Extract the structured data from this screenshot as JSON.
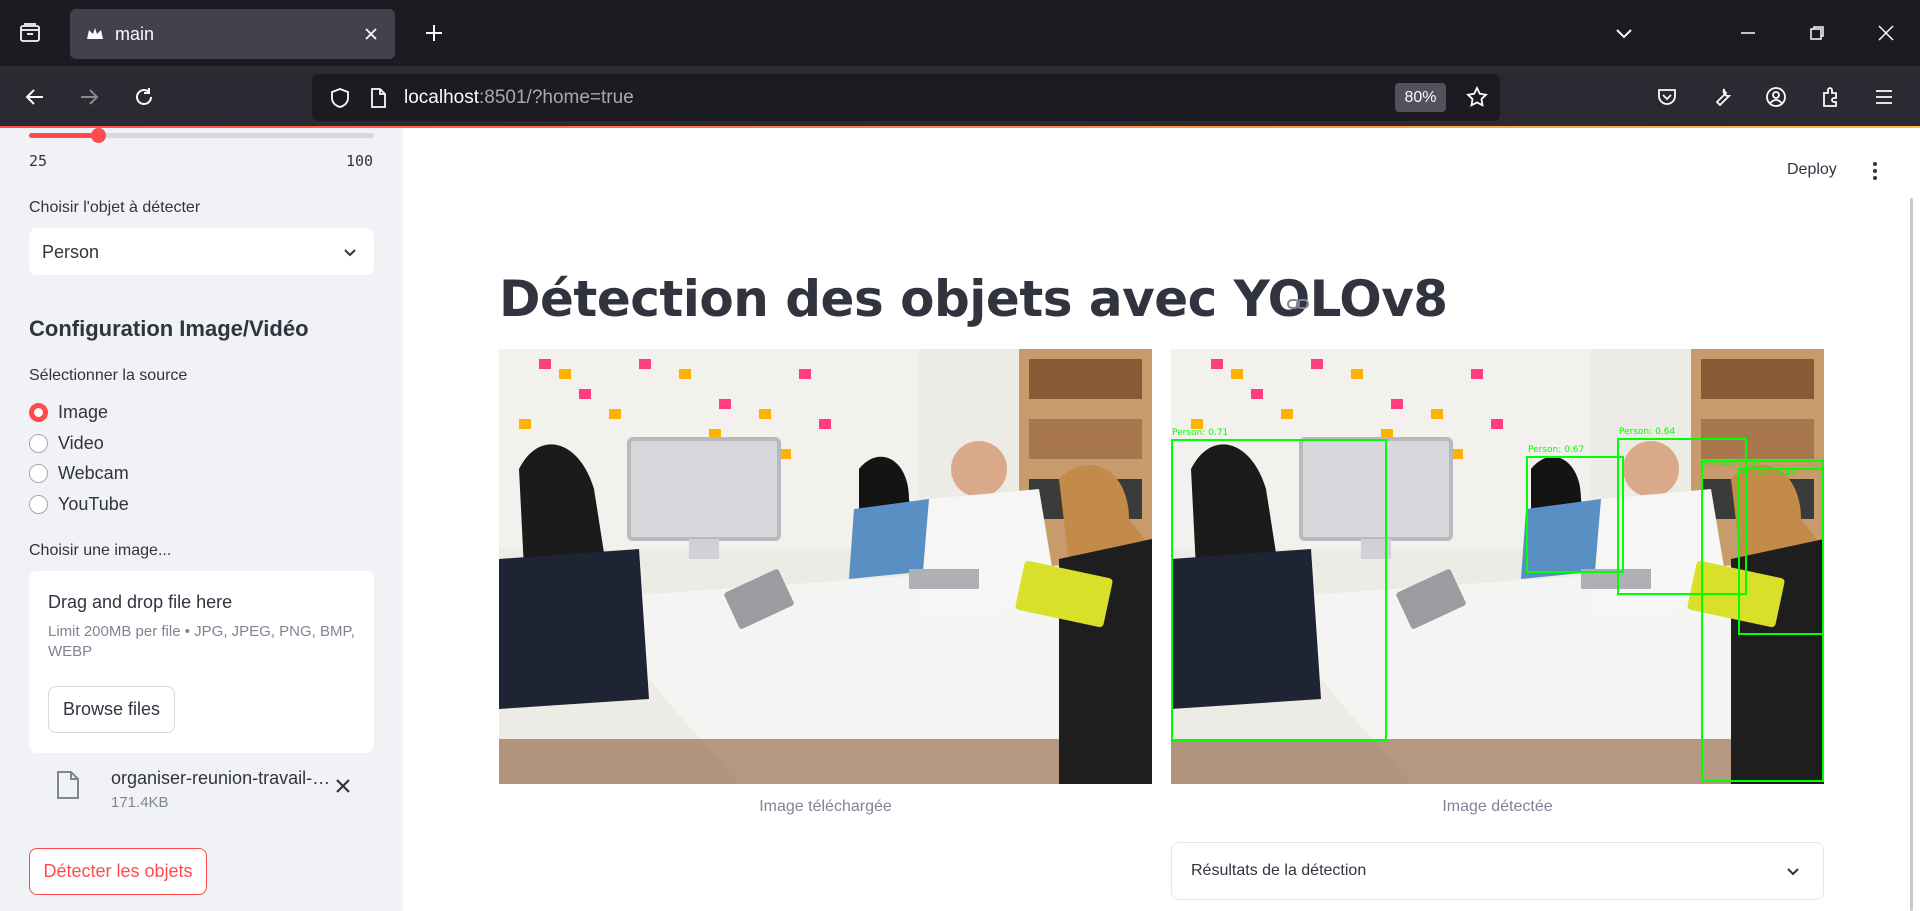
{
  "browser": {
    "tab_title": "main",
    "url_host": "localhost",
    "url_rest": ":8501/?home=true",
    "zoom": "80%",
    "icons": [
      "tab-overview-icon",
      "streamlit-favicon",
      "close-tab-icon",
      "new-tab-icon",
      "tab-list-chevron-icon",
      "minimize-icon",
      "restore-icon",
      "close-window-icon",
      "back-icon",
      "forward-icon",
      "reload-icon",
      "shield-icon",
      "page-icon",
      "bookmark-star-icon",
      "pocket-icon",
      "wrench-icon",
      "account-icon",
      "extensions-icon",
      "menu-icon"
    ]
  },
  "sidebar": {
    "slider": {
      "min_label": "25",
      "max_label": "100",
      "value_fraction": 0.2
    },
    "object_label": "Choisir l'objet à détecter",
    "object_value": "Person",
    "config_heading": "Configuration Image/Vidéo",
    "source_label": "Sélectionner la source",
    "sources": [
      {
        "label": "Image",
        "selected": true
      },
      {
        "label": "Video",
        "selected": false
      },
      {
        "label": "Webcam",
        "selected": false
      },
      {
        "label": "YouTube",
        "selected": false
      }
    ],
    "upload_label": "Choisir une image...",
    "dropzone_title": "Drag and drop file here",
    "dropzone_sub": "Limit 200MB per file • JPG, JPEG, PNG, BMP, WEBP",
    "browse_label": "Browse files",
    "file_name": "organiser-reunion-travail-efficace.jpg",
    "file_size": "171.4KB",
    "detect_label": "Détecter les objets"
  },
  "main": {
    "deploy_label": "Deploy",
    "title": "Détection des objets avec YOLOv8",
    "caption_left": "Image téléchargée",
    "caption_right": "Image détectée",
    "expander_label": "Résultats de la détection",
    "detections": [
      {
        "label": "Person: 0.71"
      },
      {
        "label": "Person: 0.67"
      },
      {
        "label": "Person: 0.64"
      },
      {
        "label": "Person: 0.50"
      },
      {
        "label": "Person: 0.45"
      }
    ]
  },
  "colors": {
    "accent": "#ff4b4b",
    "text": "#31333f",
    "muted": "#808495",
    "sidebar_bg": "#f0f2f6",
    "bbox": "#00ff00"
  }
}
